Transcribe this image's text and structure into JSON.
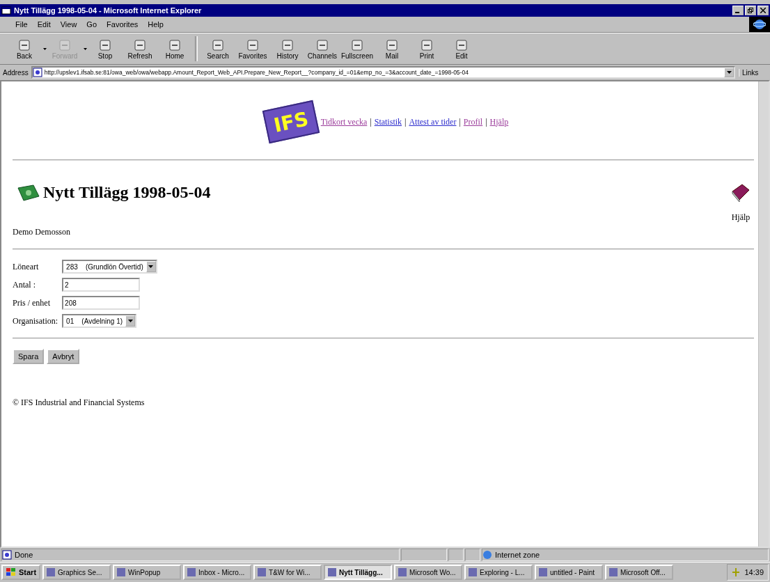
{
  "window": {
    "title": "Nytt Tillägg 1998-05-04 - Microsoft Internet Explorer"
  },
  "menu": [
    "File",
    "Edit",
    "View",
    "Go",
    "Favorites",
    "Help"
  ],
  "toolbar": [
    {
      "label": "Back",
      "disabled": false,
      "dropdown": true
    },
    {
      "label": "Forward",
      "disabled": true,
      "dropdown": true
    },
    {
      "label": "Stop",
      "disabled": false,
      "dropdown": false
    },
    {
      "label": "Refresh",
      "disabled": false,
      "dropdown": false
    },
    {
      "label": "Home",
      "disabled": false,
      "dropdown": false
    },
    {
      "label": "Search",
      "disabled": false,
      "dropdown": false
    },
    {
      "label": "Favorites",
      "disabled": false,
      "dropdown": false
    },
    {
      "label": "History",
      "disabled": false,
      "dropdown": false
    },
    {
      "label": "Channels",
      "disabled": false,
      "dropdown": false
    },
    {
      "label": "Fullscreen",
      "disabled": false,
      "dropdown": false
    },
    {
      "label": "Mail",
      "disabled": false,
      "dropdown": false
    },
    {
      "label": "Print",
      "disabled": false,
      "dropdown": false
    },
    {
      "label": "Edit",
      "disabled": false,
      "dropdown": false
    }
  ],
  "address": {
    "label": "Address",
    "value": "http://upslev1.ifsab.se:81/owa_web/owa/webapp.Amount_Report_Web_API.Prepare_New_Report__?company_id_=01&emp_no_=3&account_date_=1998-05-04",
    "links": "Links"
  },
  "page": {
    "logo": "IFS",
    "nav_links": [
      {
        "label": "Tidkort vecka",
        "visited": true
      },
      {
        "label": "Statistik",
        "visited": false
      },
      {
        "label": "Attest av tider",
        "visited": false
      },
      {
        "label": "Profil",
        "visited": true
      },
      {
        "label": "Hjälp",
        "visited": true
      }
    ],
    "separator": "|",
    "heading": "Nytt Tillägg 1998-05-04",
    "help_label": "Hjälp",
    "employee": "Demo Demosson",
    "fields": [
      {
        "kind": "select",
        "label": "Löneart",
        "value": "283    (Grundlön Övertid)"
      },
      {
        "kind": "text",
        "label": "Antal :",
        "value": "2"
      },
      {
        "kind": "text",
        "label": "Pris / enhet",
        "value": "208"
      },
      {
        "kind": "select",
        "label": "Organisation:",
        "value": "01    (Avdelning 1)"
      }
    ],
    "buttons": [
      "Spara",
      "Avbryt"
    ],
    "copyright": "© IFS Industrial and Financial Systems"
  },
  "status_bar": {
    "text": "Done",
    "zone": "Internet zone"
  },
  "taskbar": {
    "start": "Start",
    "clock": "14:39",
    "items": [
      {
        "label": "Graphics Se...",
        "selected": false
      },
      {
        "label": "WinPopup",
        "selected": false
      },
      {
        "label": "Inbox - Micro...",
        "selected": false
      },
      {
        "label": "T&W for Wi...",
        "selected": false
      },
      {
        "label": "Nytt Tillägg...",
        "selected": true
      },
      {
        "label": "Microsoft Wo...",
        "selected": false
      },
      {
        "label": "Exploring - L...",
        "selected": false
      },
      {
        "label": "untitled - Paint",
        "selected": false
      },
      {
        "label": "Microsoft Off...",
        "selected": false
      }
    ]
  }
}
